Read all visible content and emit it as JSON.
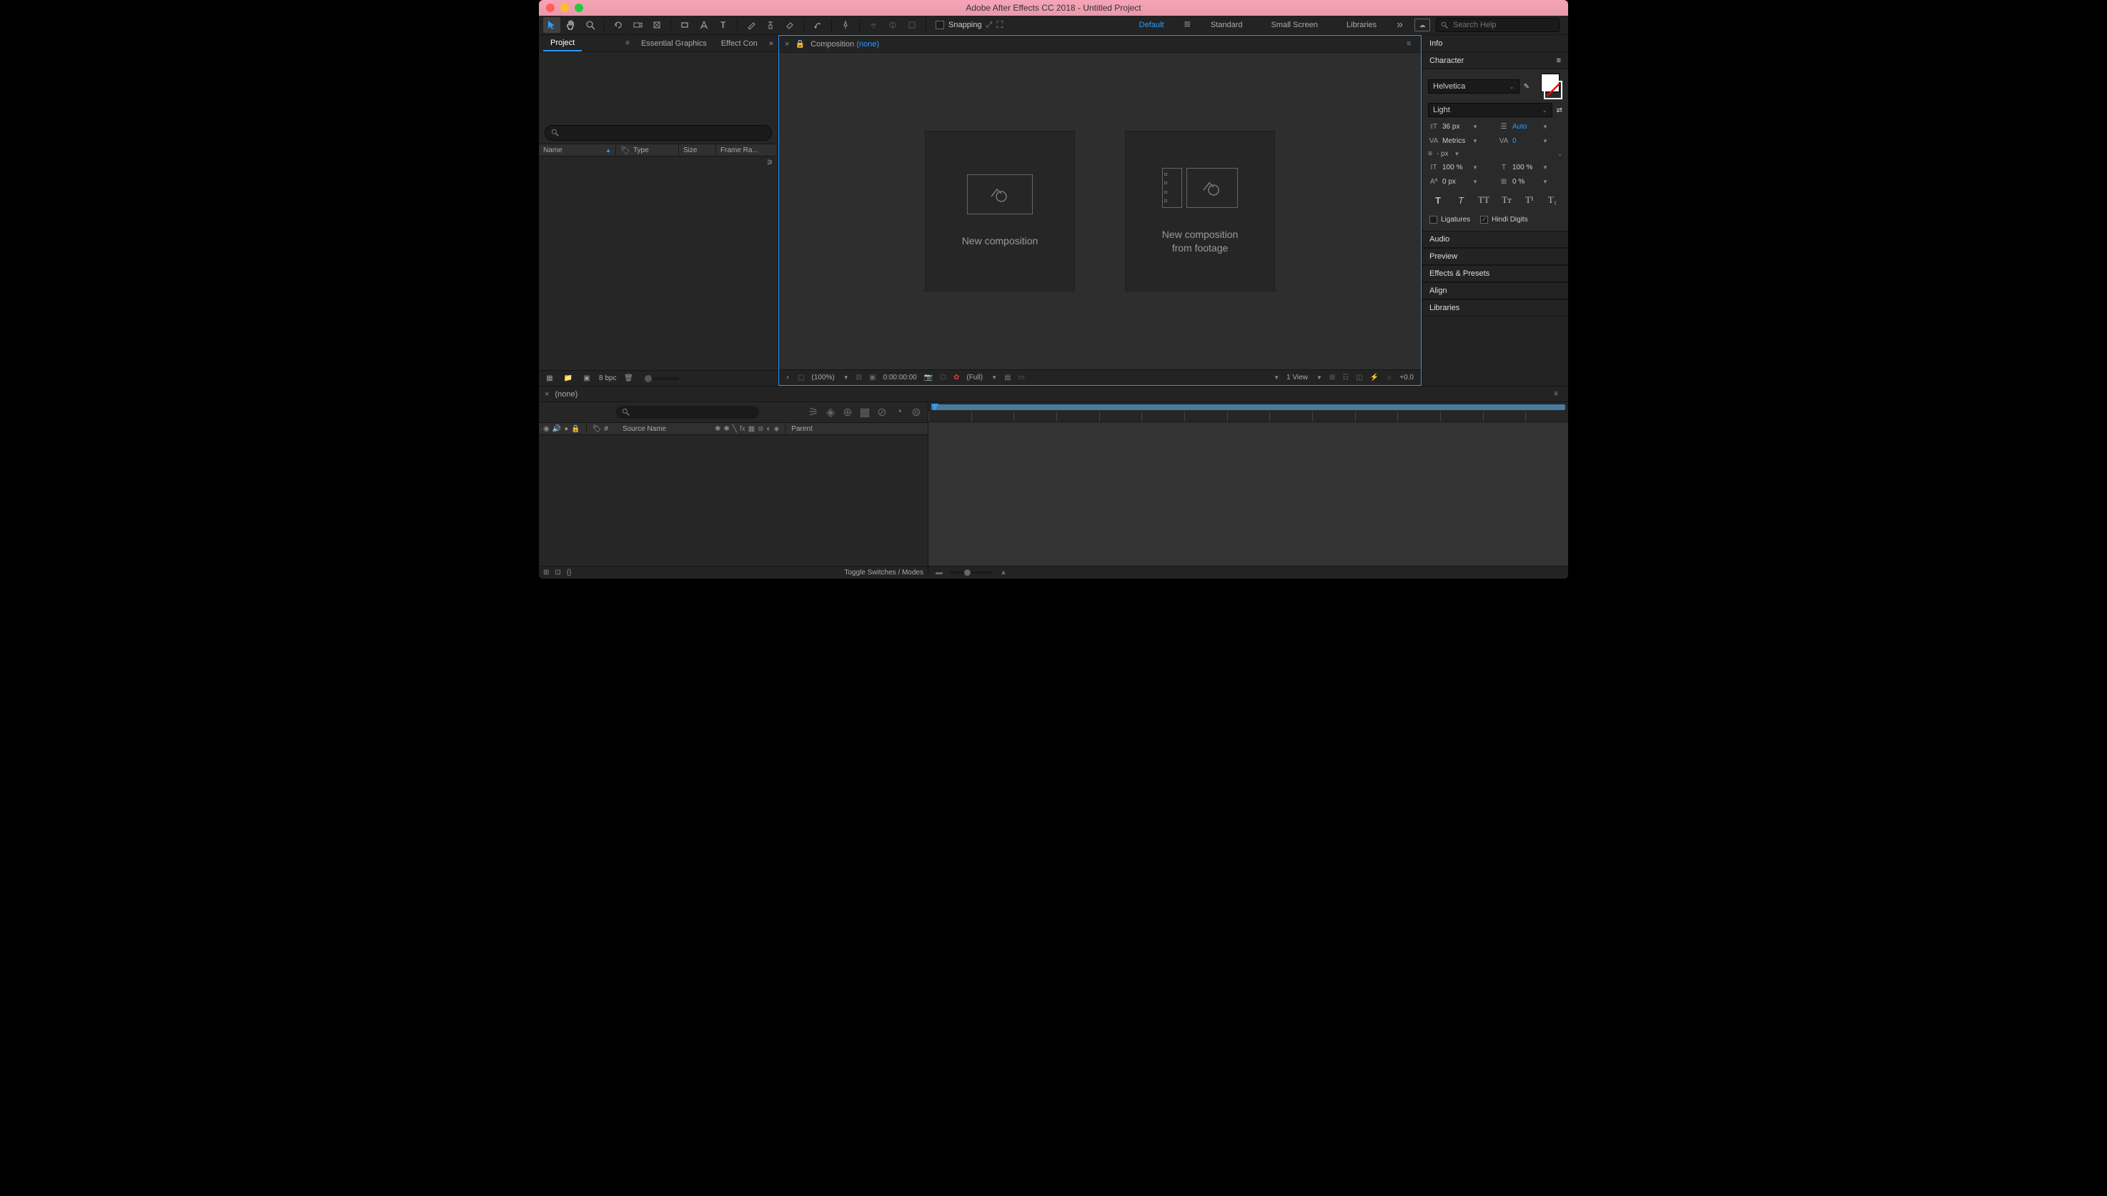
{
  "titlebar": {
    "title": "Adobe After Effects CC 2018 - Untitled Project"
  },
  "toolbar": {
    "snapping_label": "Snapping",
    "workspaces": [
      "Default",
      "Standard",
      "Small Screen",
      "Libraries"
    ],
    "active_workspace": 0,
    "search_placeholder": "Search Help"
  },
  "project_panel": {
    "tabs": [
      "Project",
      "Essential Graphics",
      "Effect Con"
    ],
    "active_tab": 0,
    "columns": {
      "name": "Name",
      "type": "Type",
      "size": "Size",
      "frame_rate": "Frame Ra..."
    },
    "footer": {
      "bpc": "8 bpc"
    }
  },
  "composition_panel": {
    "tab_label": "Composition",
    "tab_none": "(none)",
    "card_new": "New composition",
    "card_footage_line1": "New composition",
    "card_footage_line2": "from footage",
    "footer": {
      "zoom": "(100%)",
      "timecode": "0:00:00:00",
      "resolution": "(Full)",
      "views": "1 View",
      "exposure": "+0.0"
    }
  },
  "right_panels": {
    "info": "Info",
    "character": {
      "title": "Character",
      "font": "Helvetica",
      "style": "Light",
      "size": "36 px",
      "leading": "Auto",
      "kerning": "Metrics",
      "tracking": "0",
      "stroke": "- px",
      "vscale": "100 %",
      "hscale": "100 %",
      "baseline": "0 px",
      "tsume": "0 %",
      "ligatures": "Ligatures",
      "hindi": "Hindi Digits"
    },
    "collapsed": [
      "Audio",
      "Preview",
      "Effects & Presets",
      "Align",
      "Libraries"
    ]
  },
  "timeline": {
    "tab": "(none)",
    "columns": {
      "num": "#",
      "source": "Source Name",
      "parent": "Parent"
    },
    "footer": {
      "toggle": "Toggle Switches / Modes"
    }
  }
}
